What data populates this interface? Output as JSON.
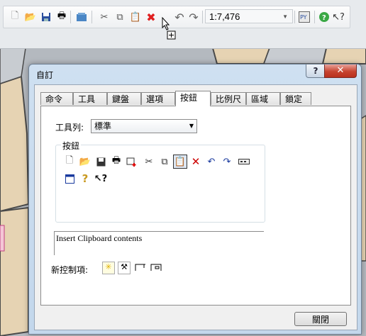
{
  "toolbar": {
    "scale": "1:7,476",
    "icons": [
      "new-document-icon",
      "open-folder-icon",
      "save-icon",
      "print-icon",
      "add-data-icon",
      "cut-icon",
      "copy-icon",
      "paste-icon",
      "delete-icon",
      "undo-icon",
      "redo-icon",
      "python-icon",
      "help-icon",
      "whats-this-icon"
    ]
  },
  "dialog": {
    "title": "自訂",
    "help_label": "?",
    "close_glyph": "✕",
    "tabs": [
      "命令",
      "工具列",
      "鍵盤",
      "選項",
      "按鈕",
      "比例尺",
      "區域",
      "鎖定"
    ],
    "active_tab": "按鈕",
    "toolbar_label": "工具列:",
    "toolbar_value": "標準",
    "group_title": "按鈕",
    "buttons_row1": [
      "new-document-icon",
      "open-folder-icon",
      "save-icon",
      "print-icon",
      "add-data-icon",
      "cut-icon",
      "copy-icon",
      "paste-icon",
      "delete-icon",
      "undo-icon",
      "redo-icon",
      "scale-box-icon"
    ],
    "buttons_row2": [
      "window-icon",
      "identify-icon",
      "whats-this-icon"
    ],
    "selected_button": "paste-icon",
    "description": "Insert Clipboard contents",
    "new_control_label": "新控制項:",
    "close_button": "關閉"
  }
}
